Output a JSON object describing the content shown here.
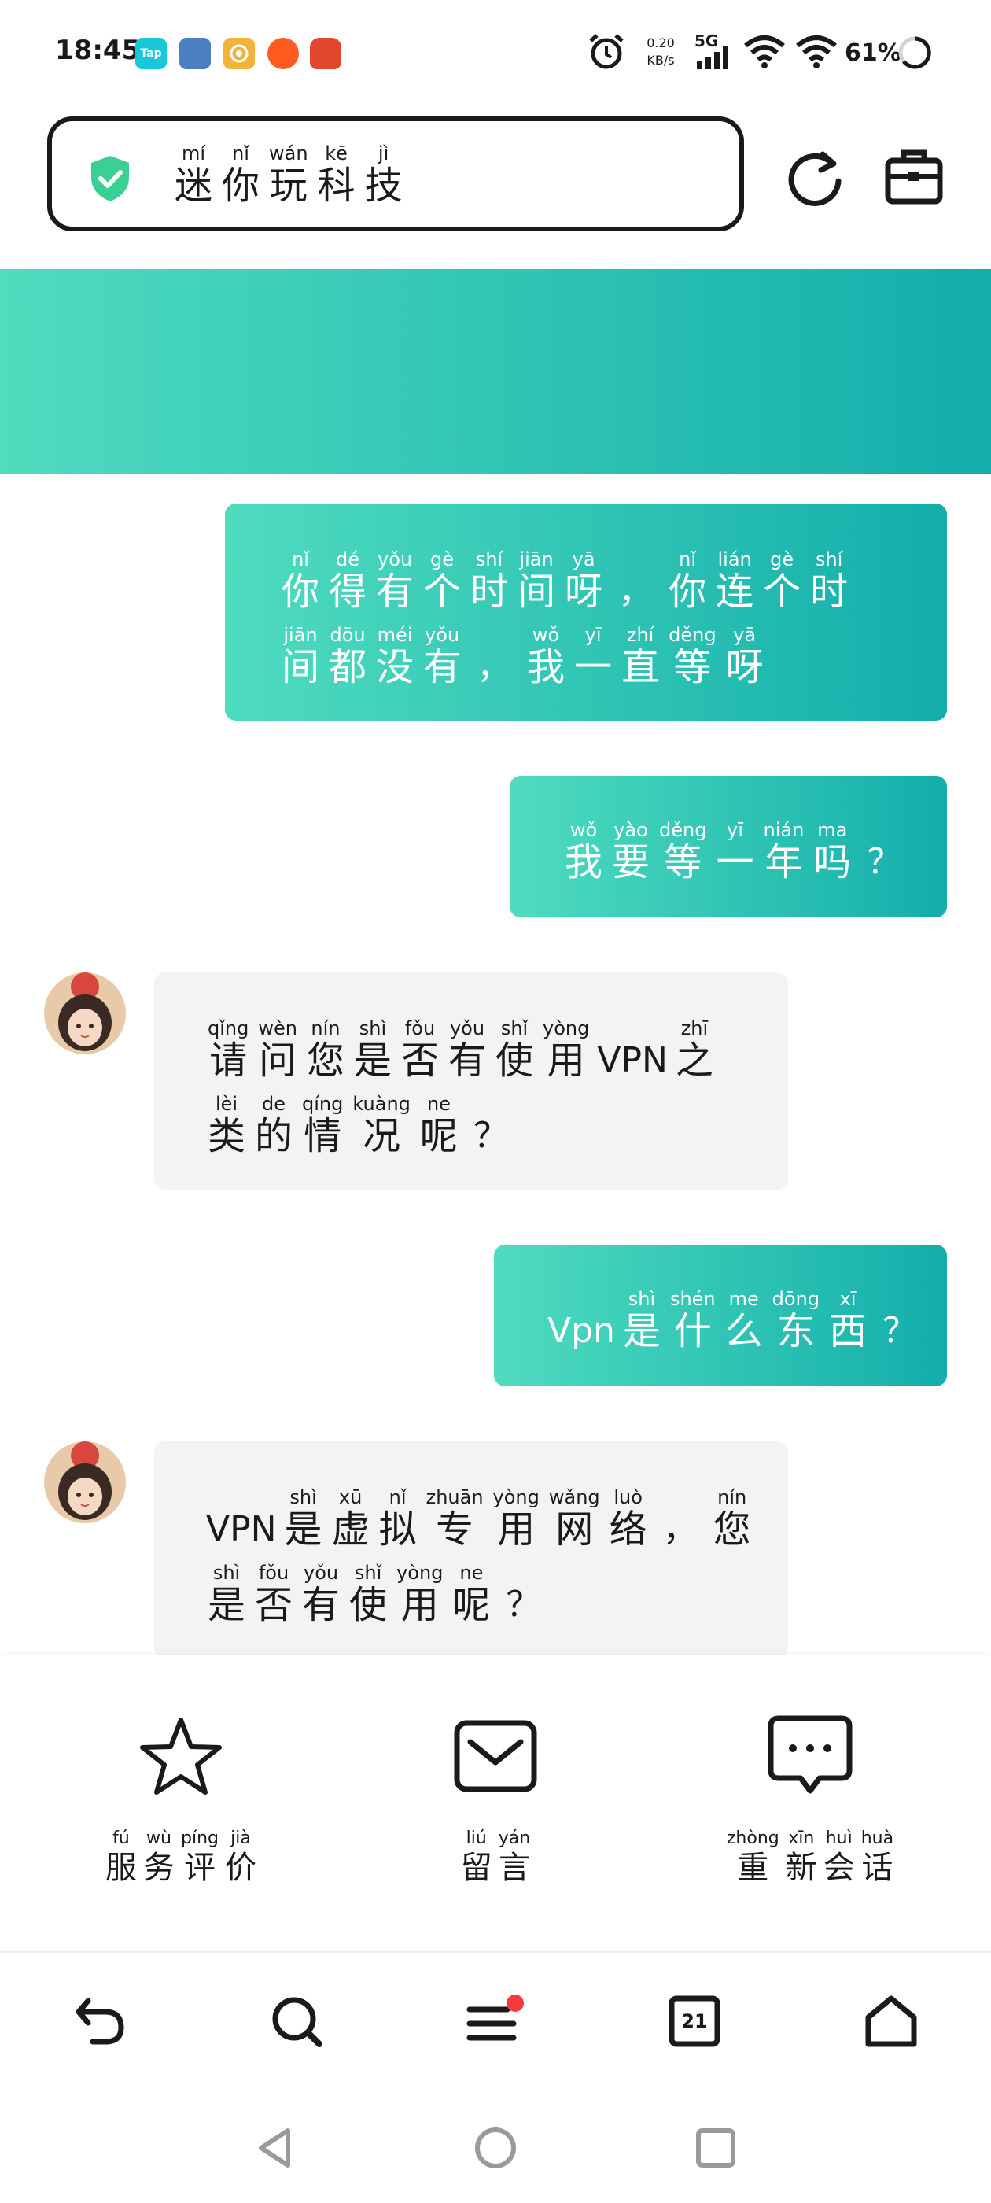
{
  "status_bar": {
    "time": "18:45",
    "apps": [
      "Tap",
      "game-app",
      "coin-app",
      "weibo-app",
      "cake-app"
    ],
    "net_speed_value": "0.20",
    "net_speed_unit": "KB/s",
    "network": "5G",
    "battery": "61%"
  },
  "url_bar": {
    "title": [
      {
        "h": "迷",
        "p": "mí"
      },
      {
        "h": "你",
        "p": "nǐ"
      },
      {
        "h": "玩",
        "p": "wán"
      },
      {
        "h": "科",
        "p": "kē"
      },
      {
        "h": "技",
        "p": "jì"
      }
    ]
  },
  "colors": {
    "accent_start": "#4fdcbf",
    "accent_end": "#13aeab",
    "incoming_bubble": "#f3f3f3",
    "shield": "#3ccf94",
    "notification_dot": "#f23b3b"
  },
  "messages": [
    {
      "from": "user",
      "lines": [
        [
          [
            "你",
            "nǐ"
          ],
          [
            "得",
            "dé"
          ],
          [
            "有",
            "yǒu"
          ],
          [
            "个",
            "gè"
          ],
          [
            "时",
            "shí"
          ],
          [
            "间",
            "jiān"
          ],
          [
            "呀",
            "yā"
          ],
          [
            "，",
            ""
          ],
          [
            "你",
            "nǐ"
          ],
          [
            "连",
            "lián"
          ],
          [
            "个",
            "gè"
          ],
          [
            "时",
            "shí"
          ]
        ],
        [
          [
            "间",
            "jiān"
          ],
          [
            "都",
            "dōu"
          ],
          [
            "没",
            "méi"
          ],
          [
            "有",
            "yǒu"
          ],
          [
            "，",
            ""
          ],
          [
            "我",
            "wǒ"
          ],
          [
            "一",
            "yī"
          ],
          [
            "直",
            "zhí"
          ],
          [
            "等",
            "děng"
          ],
          [
            "呀",
            "yā"
          ]
        ]
      ]
    },
    {
      "from": "user",
      "lines": [
        [
          [
            "我",
            "wǒ"
          ],
          [
            "要",
            "yào"
          ],
          [
            "等",
            "děng"
          ],
          [
            "一",
            "yī"
          ],
          [
            "年",
            "nián"
          ],
          [
            "吗",
            "ma"
          ],
          [
            "？",
            ""
          ]
        ]
      ]
    },
    {
      "from": "bot",
      "lines": [
        [
          [
            "请",
            "qǐng"
          ],
          [
            "问",
            "wèn"
          ],
          [
            "您",
            "nín"
          ],
          [
            "是",
            "shì"
          ],
          [
            "否",
            "fǒu"
          ],
          [
            "有",
            "yǒu"
          ],
          [
            "使",
            "shǐ"
          ],
          [
            "用",
            "yòng"
          ],
          [
            "VPN",
            ""
          ],
          [
            "之",
            "zhī"
          ]
        ],
        [
          [
            "类",
            "lèi"
          ],
          [
            "的",
            "de"
          ],
          [
            "情",
            "qíng"
          ],
          [
            "况",
            "kuàng"
          ],
          [
            "呢",
            "ne"
          ],
          [
            "？",
            ""
          ]
        ]
      ]
    },
    {
      "from": "user",
      "lines": [
        [
          [
            "Vpn",
            ""
          ],
          [
            "是",
            "shì"
          ],
          [
            "什",
            "shén"
          ],
          [
            "么",
            "me"
          ],
          [
            "东",
            "dōng"
          ],
          [
            "西",
            "xī"
          ],
          [
            "？",
            ""
          ]
        ]
      ]
    },
    {
      "from": "bot",
      "lines": [
        [
          [
            "VPN",
            ""
          ],
          [
            "是",
            "shì"
          ],
          [
            "虚",
            "xū"
          ],
          [
            "拟",
            "nǐ"
          ],
          [
            "专",
            "zhuān"
          ],
          [
            "用",
            "yòng"
          ],
          [
            "网",
            "wǎng"
          ],
          [
            "络",
            "luò"
          ],
          [
            "，",
            ""
          ],
          [
            "您",
            "nín"
          ]
        ],
        [
          [
            "是",
            "shì"
          ],
          [
            "否",
            "fǒu"
          ],
          [
            "有",
            "yǒu"
          ],
          [
            "使",
            "shǐ"
          ],
          [
            "用",
            "yòng"
          ],
          [
            "呢",
            "ne"
          ],
          [
            "？",
            ""
          ]
        ]
      ]
    }
  ],
  "actions": [
    {
      "name": "rate-service",
      "icon": "star-icon",
      "label": [
        [
          "服",
          "fú"
        ],
        [
          "务",
          "wù"
        ],
        [
          "评",
          "píng"
        ],
        [
          "价",
          "jià"
        ]
      ]
    },
    {
      "name": "leave-message",
      "icon": "mail-icon",
      "label": [
        [
          "留",
          "liú"
        ],
        [
          "言",
          "yán"
        ]
      ]
    },
    {
      "name": "new-conversation",
      "icon": "chat-bubble-icon",
      "label": [
        [
          "重",
          "zhòng"
        ],
        [
          "新",
          "xīn"
        ],
        [
          "会",
          "huì"
        ],
        [
          "话",
          "huà"
        ]
      ]
    }
  ],
  "nav": {
    "tabs_count": "21"
  }
}
